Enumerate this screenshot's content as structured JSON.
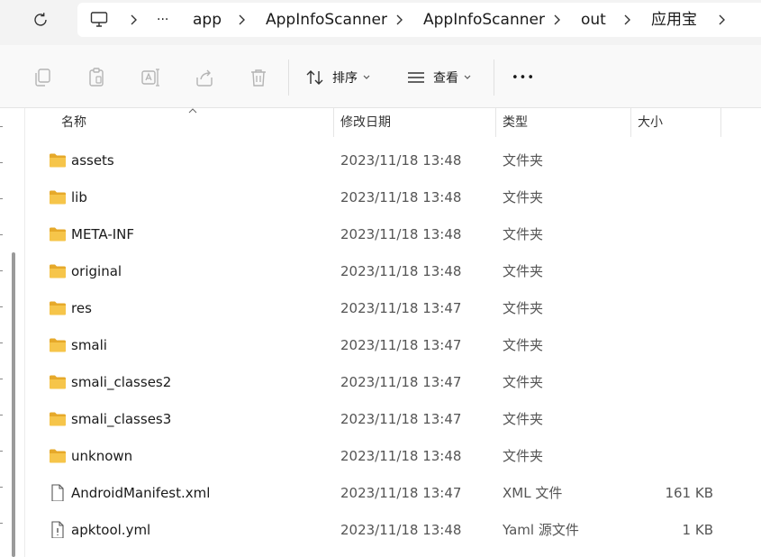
{
  "breadcrumb": {
    "ellipsis": "···",
    "items": [
      "app",
      "AppInfoScanner",
      "AppInfoScanner",
      "out",
      "应用宝"
    ]
  },
  "toolbar": {
    "sort_label": "排序",
    "view_label": "查看",
    "more_label": "•••"
  },
  "columns": {
    "name": "名称",
    "date": "修改日期",
    "type": "类型",
    "size": "大小"
  },
  "files": [
    {
      "name": "assets",
      "date": "2023/11/18 13:48",
      "type": "文件夹",
      "size": "",
      "icon": "folder-icon"
    },
    {
      "name": "lib",
      "date": "2023/11/18 13:48",
      "type": "文件夹",
      "size": "",
      "icon": "folder-icon"
    },
    {
      "name": "META-INF",
      "date": "2023/11/18 13:48",
      "type": "文件夹",
      "size": "",
      "icon": "folder-icon"
    },
    {
      "name": "original",
      "date": "2023/11/18 13:48",
      "type": "文件夹",
      "size": "",
      "icon": "folder-icon"
    },
    {
      "name": "res",
      "date": "2023/11/18 13:47",
      "type": "文件夹",
      "size": "",
      "icon": "folder-icon"
    },
    {
      "name": "smali",
      "date": "2023/11/18 13:47",
      "type": "文件夹",
      "size": "",
      "icon": "folder-icon"
    },
    {
      "name": "smali_classes2",
      "date": "2023/11/18 13:47",
      "type": "文件夹",
      "size": "",
      "icon": "folder-icon"
    },
    {
      "name": "smali_classes3",
      "date": "2023/11/18 13:47",
      "type": "文件夹",
      "size": "",
      "icon": "folder-icon"
    },
    {
      "name": "unknown",
      "date": "2023/11/18 13:48",
      "type": "文件夹",
      "size": "",
      "icon": "folder-icon"
    },
    {
      "name": "AndroidManifest.xml",
      "date": "2023/11/18 13:47",
      "type": "XML 文件",
      "size": "161 KB",
      "icon": "document-icon"
    },
    {
      "name": "apktool.yml",
      "date": "2023/11/18 13:48",
      "type": "Yaml 源文件",
      "size": "1 KB",
      "icon": "yaml-file-icon"
    }
  ],
  "colors": {
    "folder": "#f6c54a",
    "folder_dark": "#e6a92a",
    "disabled_icon": "#b4b4b4"
  }
}
